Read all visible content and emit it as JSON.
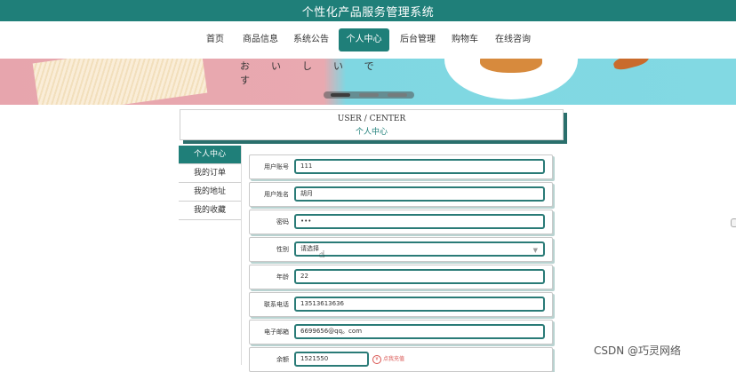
{
  "app": {
    "title": "个性化产品服务管理系统"
  },
  "nav": {
    "items": [
      {
        "label": "首页"
      },
      {
        "label": "商品信息"
      },
      {
        "label": "系统公告"
      },
      {
        "label": "个人中心"
      },
      {
        "label": "后台管理"
      },
      {
        "label": "购物车"
      },
      {
        "label": "在线咨询"
      }
    ],
    "active_index": 3
  },
  "banner": {
    "text": "おいしいです"
  },
  "center": {
    "title_en": "USER / CENTER",
    "title_cn": "个人中心"
  },
  "sidebar": {
    "items": [
      {
        "label": "个人中心"
      },
      {
        "label": "我的订单"
      },
      {
        "label": "我的地址"
      },
      {
        "label": "我的收藏"
      }
    ]
  },
  "form": {
    "account": {
      "label": "用户账号",
      "value": "111"
    },
    "name": {
      "label": "用户姓名",
      "value": "胡月"
    },
    "password": {
      "label": "密码",
      "value": "•••"
    },
    "gender": {
      "label": "性别",
      "value": "请选择"
    },
    "age": {
      "label": "年龄",
      "value": "22"
    },
    "phone": {
      "label": "联系电话",
      "value": "13513613636"
    },
    "email": {
      "label": "电子邮箱",
      "value": "6699656@qq。com"
    },
    "balance": {
      "label": "余额",
      "value": "1521550",
      "recharge_label": "点我充值"
    }
  },
  "watermark": "CSDN @巧灵网络",
  "colors": {
    "primary": "#1f7f79",
    "accent_red": "#d9534f"
  }
}
